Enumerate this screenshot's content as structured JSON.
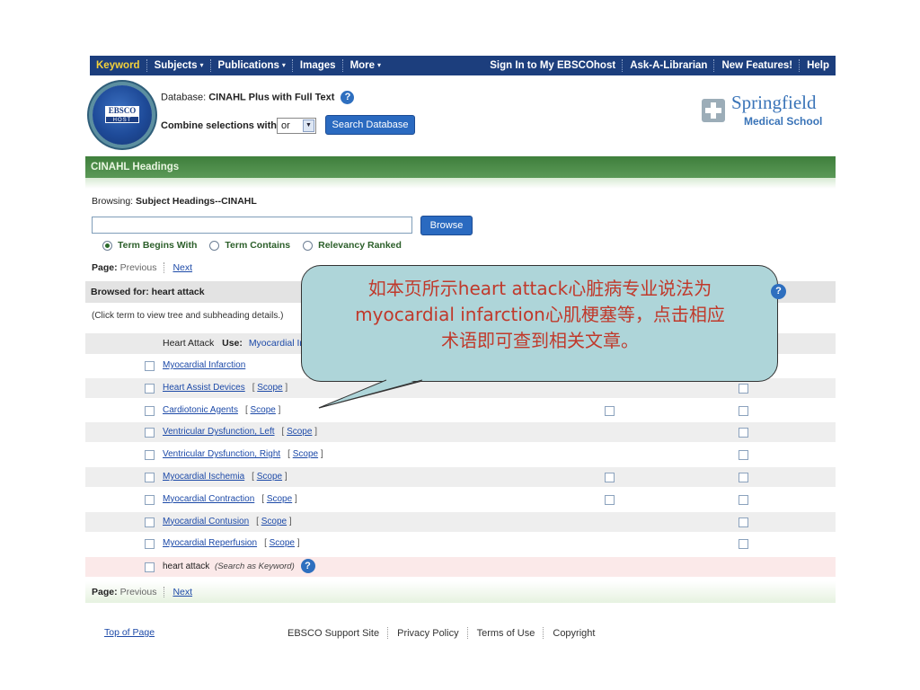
{
  "topnav": {
    "left": [
      {
        "label": "Keyword",
        "caret": false
      },
      {
        "label": "Subjects",
        "caret": true
      },
      {
        "label": "Publications",
        "caret": true
      },
      {
        "label": "Images",
        "caret": false
      },
      {
        "label": "More",
        "caret": true
      }
    ],
    "right": [
      "Sign In to My EBSCOhost",
      "Ask-A-Librarian",
      "New Features!",
      "Help"
    ],
    "caret_glyph": "▾"
  },
  "header": {
    "logo_top": "EBSCO",
    "logo_bottom": "HOST",
    "database_label": "Database:",
    "database_name": "CINAHL Plus with Full Text",
    "help_glyph": "?",
    "combine_label": "Combine selections with:",
    "combine_value": "or",
    "select_arrow": "▼",
    "search_button": "Search Database",
    "brand_name": "Springfield",
    "brand_sub": "Medical School"
  },
  "headings_bar": "CINAHL Headings",
  "browsing": {
    "label": "Browsing:",
    "value": "Subject Headings--CINAHL"
  },
  "browse_input_value": "",
  "browse_button": "Browse",
  "radios": [
    {
      "label": "Term Begins With",
      "checked": true
    },
    {
      "label": "Term Contains",
      "checked": false
    },
    {
      "label": "Relevancy Ranked",
      "checked": false
    }
  ],
  "pager": {
    "label": "Page:",
    "previous": "Previous",
    "next": "Next"
  },
  "browsed_for": {
    "label": "Browsed for: heart attack"
  },
  "click_hint": "(Click term to view tree and subheading details.)",
  "use_row": {
    "term": "Heart Attack",
    "use": "Use:",
    "target": "Myocardial Infarction"
  },
  "scope_label": "Scope",
  "rows": [
    {
      "term": "Myocardial Infarction",
      "scope": false,
      "cb2": false,
      "cb3": false
    },
    {
      "term": "Heart Assist Devices",
      "scope": true,
      "cb2": false,
      "cb3": true
    },
    {
      "term": "Cardiotonic Agents",
      "scope": true,
      "cb2": true,
      "cb3": true
    },
    {
      "term": "Ventricular Dysfunction, Left",
      "scope": true,
      "cb2": false,
      "cb3": true
    },
    {
      "term": "Ventricular Dysfunction, Right",
      "scope": true,
      "cb2": false,
      "cb3": true
    },
    {
      "term": "Myocardial Ischemia",
      "scope": true,
      "cb2": true,
      "cb3": true
    },
    {
      "term": "Myocardial Contraction",
      "scope": true,
      "cb2": true,
      "cb3": true
    },
    {
      "term": "Myocardial Contusion",
      "scope": true,
      "cb2": false,
      "cb3": true
    },
    {
      "term": "Myocardial Reperfusion",
      "scope": true,
      "cb2": false,
      "cb3": true
    }
  ],
  "keyword_row": {
    "term": "heart attack",
    "note": "(Search as Keyword)"
  },
  "footer": {
    "top_of_page": "Top of Page",
    "links": [
      "EBSCO Support Site",
      "Privacy Policy",
      "Terms of Use",
      "Copyright"
    ]
  },
  "callout": {
    "line1": "如本页所示heart attack心脏病专业说法为",
    "line2": "myocardial infarction心肌梗塞等，点击相应",
    "line3": "术语即可查到相关文章。"
  },
  "colors": {
    "nav": "#1c3e7d",
    "green_bar": "#4a8a46",
    "button": "#2a6ac0",
    "callout": "#aed5d9",
    "callout_text": "#c0392b"
  }
}
